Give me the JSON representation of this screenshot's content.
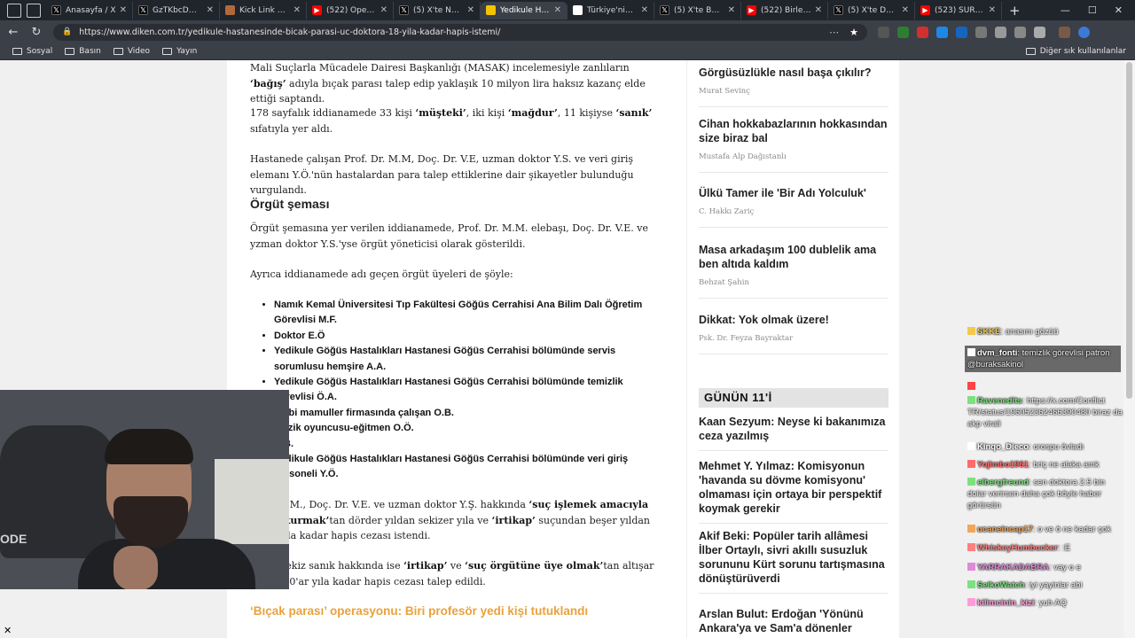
{
  "browser": {
    "tabs": [
      {
        "title": "Anasayfa / X",
        "icon": "x-logo",
        "color": "#000000"
      },
      {
        "title": "GzTKbcDWgAA…",
        "icon": "x-logo",
        "color": "#000000"
      },
      {
        "title": "Kick Link Crawler",
        "icon": "crawler-icon",
        "color": "#b06a3a"
      },
      {
        "title": "(522) Operasyon",
        "icon": "youtube-icon",
        "color": "#ff0000"
      },
      {
        "title": "(5) X'te Nefes G…",
        "icon": "x-logo",
        "color": "#000000"
      },
      {
        "title": "Yedikule Hastan…",
        "icon": "diken-icon",
        "color": "#f5c400",
        "active": true
      },
      {
        "title": "Türkiye'nin orm…",
        "icon": "news-icon",
        "color": "#ffffff"
      },
      {
        "title": "(5) X'te BPT: \"Ra…",
        "icon": "x-logo",
        "color": "#000000"
      },
      {
        "title": "(522) Birleşik Kr…",
        "icon": "youtube-icon",
        "color": "#ff0000"
      },
      {
        "title": "(5) X'te DarkWe…",
        "icon": "x-logo",
        "color": "#000000"
      },
      {
        "title": "(523) SURİYE Kü…",
        "icon": "youtube-icon",
        "color": "#ff0000"
      }
    ],
    "url": "https://www.diken.com.tr/yedikule-hastanesinde-bicak-parasi-uc-doktora-18-yila-kadar-hapis-istemi/",
    "bookmarks": [
      "Sosyal",
      "Basın",
      "Video",
      "Yayın"
    ],
    "bookmarks_other": "Diğer sık kullanılanlar"
  },
  "article": {
    "p1_a": "Mali Suçlarla Mücadele Dairesi Başkanlığı (MASAK) incelemesiyle zanlıların ",
    "p1_b": "‘bağış’",
    "p1_c": " adıyla bıçak parası talep edip yaklaşık 10 milyon lira haksız kazanç elde ettiği saptandı.",
    "p2_a": "178 sayfalık iddianamede 33 kişi ",
    "p2_b": "‘müşteki’",
    "p2_c": ", iki kişi ",
    "p2_d": "‘mağdur’",
    "p2_e": ", 11 kişiyse ",
    "p2_f": "‘sanık’",
    "p2_g": " sıfatıyla yer aldı.",
    "p3": "Hastanede çalışan Prof. Dr. M.M, Doç. Dr. V.E, uzman doktor Y.S. ve veri giriş elemanı Y.Ö.'nün hastalardan para talep ettiklerine dair şikayetler bulunduğu vurgulandı.",
    "h_orgut": "Örgüt şeması",
    "p4": "Örgüt şemasına yer verilen iddianamede, Prof. Dr. M.M. elebaşı, Doç. Dr. V.E. ve yzman doktor Y.S.'yse örgüt yöneticisi olarak gösterildi.",
    "p5": "Ayrıca iddianamede adı geçen örgüt üyeleri de şöyle:",
    "members": [
      "Namık Kemal Üniversitesi Tıp Fakültesi Göğüs Cerrahisi Ana Bilim Dalı Öğretim Görevlisi M.F.",
      "Doktor E.Ö",
      "Yedikule Göğüs Hastalıkları Hastanesi Göğüs Cerrahisi bölümünde servis sorumlusu hemşire A.A.",
      "Yedikule Göğüs Hastalıkları Hastanesi Göğüs Cerrahisi bölümünde temizlik görevlisi Ö.A.",
      "Tıbbi mamuller firmasında çalışan O.B.",
      "Müzik oyuncusu-eğitmen O.Ö.",
      "A.B.",
      "Yedikule Göğüs Hastalıkları Hastanesi Göğüs Cerrahisi bölümünde veri giriş personeli Y.Ö."
    ],
    "p6_a": "Prof. M.M., Doç. Dr. V.E. ve uzman doktor Y.Ş. hakkında ",
    "p6_b": "‘suç işlemek amacıyla örgüt kurmak’",
    "p6_c": "tan dörder yıldan sekizer yıla ve ",
    "p6_d": "‘irtikap’",
    "p6_e": " suçundan beşer yıldan 10'ar yıla kadar hapis cezası istendi.",
    "p7_a": "Diğer sekiz sanık hakkında ise ",
    "p7_b": "‘irtikap’",
    "p7_c": " ve ",
    "p7_d": "‘suç örgütüne üye olmak’",
    "p7_e": "tan altışar yıldan 10'ar yıla kadar hapis cezası talep edildi.",
    "related_heading": "‘Bıçak parası’ operasyonu: Biri profesör yedi kişi tutuklandı"
  },
  "sidebar": {
    "columns": [
      {
        "title": "Görgüsüzlükle nasıl başa çıkılır?",
        "author": "Murat Sevinç"
      },
      {
        "title": "Cihan hokkabazlarının hokkasından size biraz bal",
        "author": "Mustafa Alp Dağıstanlı"
      },
      {
        "title": "Ülkü Tamer ile 'Bir Adı Yolculuk'",
        "author": "C. Hakkı Zariç"
      },
      {
        "title": "Masa arkadaşım 100 dublelik ama ben altıda kaldım",
        "author": "Behzat Şahin"
      },
      {
        "title": "Dikkat: Yok olmak üzere!",
        "author": "Psk. Dr. Feyza Bayraktar"
      }
    ],
    "gunun_heading": "GÜNÜN 11'İ",
    "gunun": [
      "Kaan Sezyum: Neyse ki bakanımıza ceza yazılmış",
      "Mehmet Y. Yılmaz: Komisyonun 'havanda su dövme komisyonu' olmaması için ortaya bir perspektif koymak gerekir",
      "Akif Beki: Popüler tarih allâmesi İlber Ortaylı, sivri akıllı susuzluk sorununu Kürt sorunu tartışmasına dönüştürüverdi",
      "Arslan Bulut: Erdoğan 'Yönünü Ankara'ya ve Sam'a dönenler"
    ]
  },
  "webcam": {
    "overlay_text": "ODE"
  },
  "chat": [
    {
      "user": "SKKE",
      "text": "anasını gözüü",
      "color": "#f2c94c"
    },
    {
      "user": "dvm_fonti",
      "text": "temizlik görevlisi patron @buraksakinol",
      "color": "#ffffff",
      "highlight": true
    },
    {
      "user": "",
      "text": "",
      "color": "#ff4444"
    },
    {
      "user": "Ravenedits",
      "text": "https://x.com/Conflict TR/status/1960523624663904​80 biraz da akp virali",
      "color": "#7ee07e"
    },
    {
      "user": "Kinqo_Dieco",
      "text": "orospu övladı",
      "color": "#ffffff"
    },
    {
      "user": "Yojimbo1961",
      "text": "briç ne alaka amk",
      "color": "#ff6b6b"
    },
    {
      "user": "elbergfreund",
      "text": "sen doktora 2.5 bin dolar verirsen daha çok böyle haber görürsün",
      "color": "#7ee07e"
    },
    {
      "user": "ucaneincap17",
      "text": "o ve ö ne kadar çok",
      "color": "#f2a65a"
    },
    {
      "user": "WhiskeyHumbucker",
      "text": ":E",
      "color": "#ff8080"
    },
    {
      "user": "YARRAKADABRA",
      "text": "vay o e",
      "color": "#e08ad8"
    },
    {
      "user": "SeikoWatch",
      "text": "iyi yayinlar abi",
      "color": "#7ee07e"
    },
    {
      "user": "kilimcinin_kizi",
      "text": "yuh AQ",
      "color": "#ff9ad8"
    }
  ],
  "colors": {
    "accent_orange": "#e9a23b",
    "chrome_dark": "#20242b",
    "chrome_mid": "#3b3f47"
  }
}
